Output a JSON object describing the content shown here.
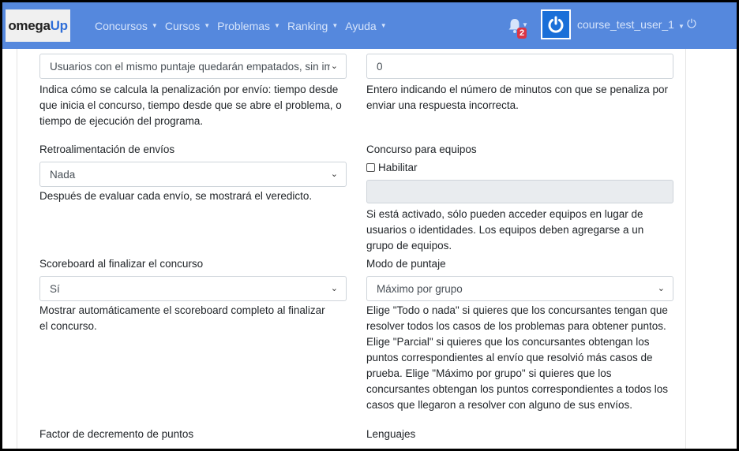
{
  "brand": {
    "part1": "omega",
    "part2": "Up"
  },
  "nav": {
    "items": [
      {
        "label": "Concursos"
      },
      {
        "label": "Cursos"
      },
      {
        "label": "Problemas"
      },
      {
        "label": "Ranking"
      },
      {
        "label": "Ayuda"
      }
    ],
    "notifications_count": "2",
    "user_name": "course_test_user_1"
  },
  "form": {
    "penalty_policy": {
      "value": "Usuarios con el mismo puntaje quedarán empatados, sin importar el tiempo",
      "help": "Indica cómo se calcula la penalización por envío: tiempo desde que inicia el concurso, tiempo desde que se abre el problema, o tiempo de ejecución del programa."
    },
    "penalty_minutes": {
      "value": "0",
      "help": "Entero indicando el número de minutos con que se penaliza por enviar una respuesta incorrecta."
    },
    "feedback": {
      "label": "Retroalimentación de envíos",
      "value": "Nada",
      "help": "Después de evaluar cada envío, se mostrará el veredicto."
    },
    "team_contest": {
      "label": "Concurso para equipos",
      "checkbox_label": "Habilitar",
      "help": "Si está activado, sólo pueden acceder equipos en lugar de usuarios o identidades. Los equipos deben agregarse a un grupo de equipos."
    },
    "scoreboard_end": {
      "label": "Scoreboard al finalizar el concurso",
      "value": "Sí",
      "help": "Mostrar automáticamente el scoreboard completo al finalizar el concurso."
    },
    "score_mode": {
      "label": "Modo de puntaje",
      "value": "Máximo por grupo",
      "help": "Elige \"Todo o nada\" si quieres que los concursantes tengan que resolver todos los casos de los problemas para obtener puntos. Elige \"Parcial\" si quieres que los concursantes obtengan los puntos correspondientes al envío que resolvió más casos de prueba. Elige \"Máximo por grupo\" si quieres que los concursantes obtengan los puntos correspondientes a todos los casos que llegaron a resolver con alguno de sus envíos."
    },
    "points_decay": {
      "label": "Factor de decremento de puntos"
    },
    "languages": {
      "label": "Lenguajes"
    }
  },
  "colors": {
    "navbar": "#5588dd",
    "badge": "#dc3545",
    "avatar": "#1a6fd8"
  }
}
